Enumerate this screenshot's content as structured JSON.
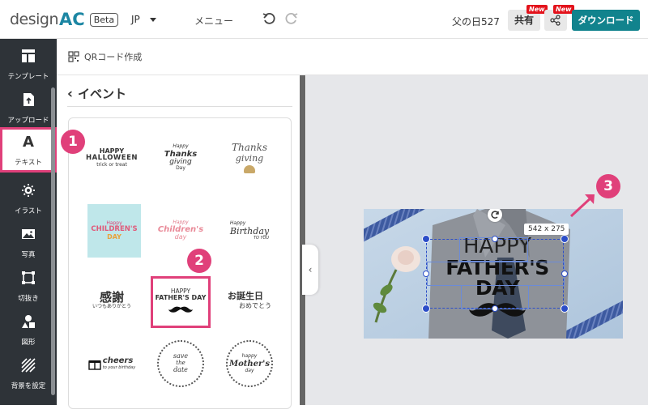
{
  "header": {
    "logo_text": "design",
    "logo_accent": "AC",
    "beta_label": "Beta",
    "language": "JP",
    "menu_label": "メニュー",
    "document_name": "父の日527",
    "share_label": "共有",
    "new_badge": "New",
    "download_label": "ダウンロード"
  },
  "sidebar": {
    "items": [
      {
        "label": "テンプレート",
        "icon": "template-icon"
      },
      {
        "label": "アップロード",
        "icon": "upload-icon"
      },
      {
        "label": "テキスト",
        "icon": "text-icon"
      },
      {
        "label": "イラスト",
        "icon": "illustration-icon"
      },
      {
        "label": "写真",
        "icon": "photo-icon"
      },
      {
        "label": "切抜き",
        "icon": "crop-icon"
      },
      {
        "label": "図形",
        "icon": "shape-icon"
      },
      {
        "label": "背景を設定",
        "icon": "background-icon"
      }
    ]
  },
  "subbar": {
    "qr_label": "QRコード作成"
  },
  "panel": {
    "title": "イベント",
    "items": [
      {
        "name": "halloween",
        "lines": [
          "HAPPY",
          "HALLOWEEN",
          "trick or treat"
        ]
      },
      {
        "name": "thanksgiving-1",
        "lines": [
          "Happy",
          "Thanks",
          "giving",
          "Day"
        ]
      },
      {
        "name": "thanksgiving-2",
        "lines": [
          "Thanks",
          "giving"
        ]
      },
      {
        "name": "childrens-day-1",
        "lines": [
          "Happy",
          "CHILDREN'S",
          "DAY"
        ]
      },
      {
        "name": "childrens-day-2",
        "lines": [
          "Happy",
          "Children's",
          "day"
        ]
      },
      {
        "name": "birthday",
        "lines": [
          "Happy",
          "Birthday",
          "TO YOU"
        ]
      },
      {
        "name": "kansha",
        "lines": [
          "感謝",
          "いつもありがとう"
        ]
      },
      {
        "name": "fathers-day",
        "lines": [
          "HAPPY",
          "FATHER'S DAY"
        ]
      },
      {
        "name": "otanjoubi",
        "lines": [
          "お誕生日",
          "おめでとう"
        ]
      },
      {
        "name": "cheers",
        "lines": [
          "cheers",
          "to your birthday"
        ]
      },
      {
        "name": "save-the-date",
        "lines": [
          "save",
          "the",
          "date"
        ]
      },
      {
        "name": "mothers-day",
        "lines": [
          "happy",
          "Mother's",
          "day"
        ]
      }
    ]
  },
  "canvas": {
    "heading": "HAPPY",
    "title": "FATHER'S DAY",
    "size_label": "542 x 275"
  },
  "steps": [
    "1",
    "2",
    "3"
  ],
  "colors": {
    "accent": "#e0407a",
    "download": "#11838d",
    "logo": "#1c86a3",
    "sidebar": "#2e3338",
    "selection": "#2c4ec8"
  }
}
